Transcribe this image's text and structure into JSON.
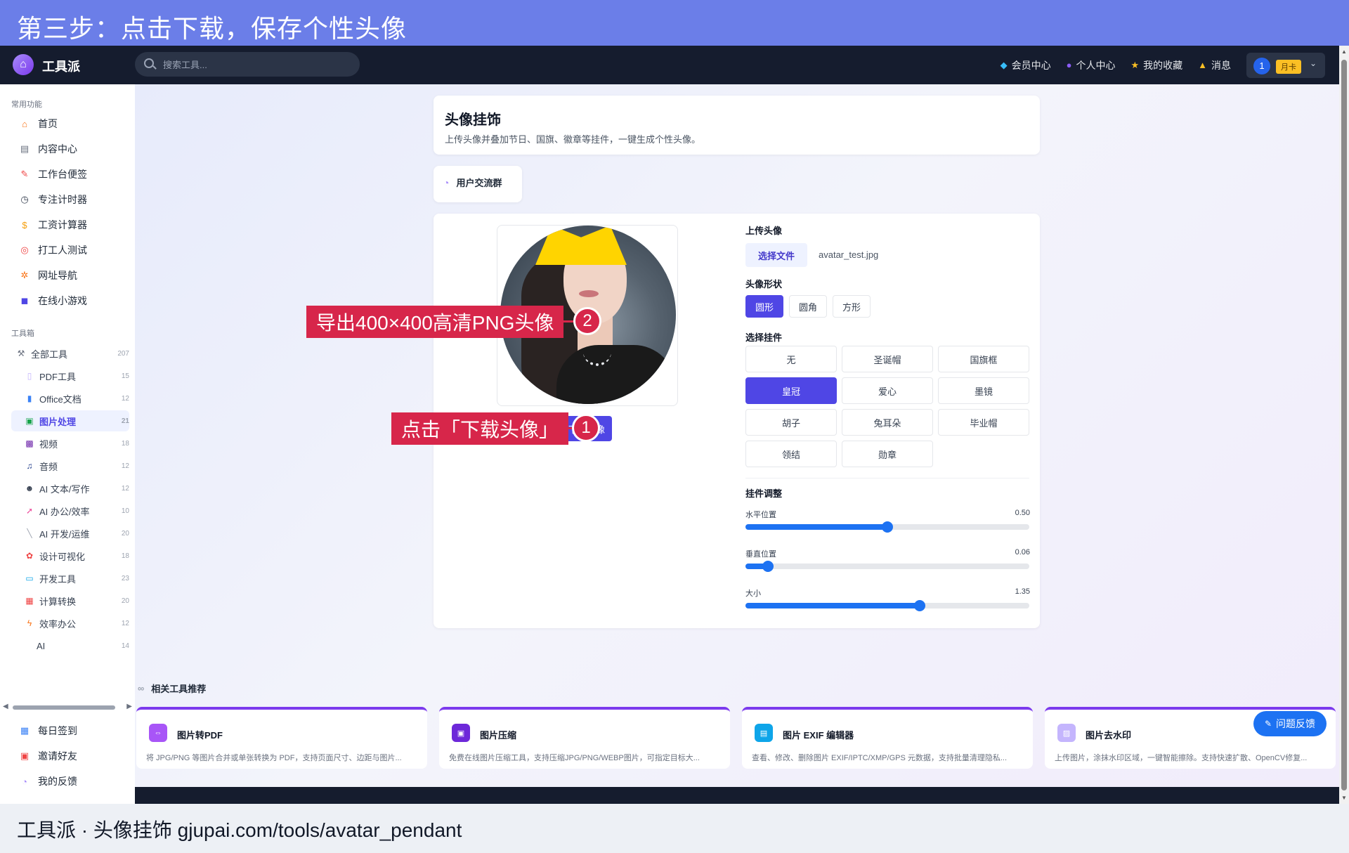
{
  "banner": {
    "title": "第三步：点击下载，保存个性头像"
  },
  "header": {
    "brand": "工具派",
    "search_placeholder": "搜索工具...",
    "nav": [
      {
        "icon": "diamond-icon",
        "label": "会员中心"
      },
      {
        "icon": "user-icon",
        "label": "个人中心"
      },
      {
        "icon": "star-icon",
        "label": "我的收藏"
      },
      {
        "icon": "bell-icon",
        "label": "消息"
      }
    ],
    "user": {
      "avatar_text": "1",
      "plan": "月卡"
    }
  },
  "sidebar": {
    "common_title": "常用功能",
    "common": [
      "首页",
      "内容中心",
      "工作台便签",
      "专注计时器",
      "工资计算器",
      "打工人测试",
      "网址导航",
      "在线小游戏"
    ],
    "toolbox_title": "工具箱",
    "all_tools": {
      "label": "全部工具",
      "count": "207"
    },
    "tools": [
      {
        "label": "PDF工具",
        "count": "15"
      },
      {
        "label": "Office文档",
        "count": "12"
      },
      {
        "label": "图片处理",
        "count": "21",
        "active": true
      },
      {
        "label": "视频",
        "count": "18"
      },
      {
        "label": "音频",
        "count": "12"
      },
      {
        "label": "AI 文本/写作",
        "count": "12"
      },
      {
        "label": "AI 办公/效率",
        "count": "10"
      },
      {
        "label": "AI 开发/运维",
        "count": "20"
      },
      {
        "label": "设计可视化",
        "count": "18"
      },
      {
        "label": "开发工具",
        "count": "23"
      },
      {
        "label": "计算转换",
        "count": "20"
      },
      {
        "label": "效率办公",
        "count": "12"
      },
      {
        "label": "AI",
        "count": "14"
      }
    ],
    "bottom": [
      "每日签到",
      "邀请好友",
      "我的反馈"
    ]
  },
  "page": {
    "title": "头像挂饰",
    "subtitle": "上传头像并叠加节日、国旗、徽章等挂件，一键生成个性头像。",
    "group_button": "用户交流群"
  },
  "editor": {
    "upload_label": "上传头像",
    "choose_file": "选择文件",
    "file_name": "avatar_test.jpg",
    "shape_label": "头像形状",
    "shapes": [
      "圆形",
      "圆角",
      "方形"
    ],
    "shape_selected": "圆形",
    "pendant_label": "选择挂件",
    "pendants": [
      "无",
      "圣诞帽",
      "国旗框",
      "皇冠",
      "爱心",
      "墨镜",
      "胡子",
      "兔耳朵",
      "毕业帽",
      "领结",
      "勋章"
    ],
    "pendant_selected": "皇冠",
    "adjust_label": "挂件调整",
    "sliders": [
      {
        "label": "水平位置",
        "value_text": "0.50",
        "fraction": 0.5
      },
      {
        "label": "垂直位置",
        "value_text": "0.06",
        "fraction": 0.08
      },
      {
        "label": "大小",
        "value_text": "1.35",
        "fraction": 0.613
      }
    ],
    "download_button": "下载头像"
  },
  "related": {
    "title": "相关工具推荐",
    "cards": [
      {
        "title": "图片转PDF",
        "desc": "将 JPG/PNG 等图片合并或单张转换为 PDF，支持页面尺寸、边距与图片...",
        "icon": "pdf-icon",
        "color": "#a855f7"
      },
      {
        "title": "图片压缩",
        "desc": "免费在线图片压缩工具，支持压缩JPG/PNG/WEBP图片，可指定目标大...",
        "icon": "compress-icon",
        "color": "#6d28d9"
      },
      {
        "title": "图片 EXIF 编辑器",
        "desc": "查看、修改、删除图片 EXIF/IPTC/XMP/GPS 元数据，支持批量清理隐私...",
        "icon": "image-icon",
        "color": "#0ea5e9"
      },
      {
        "title": "图片去水印",
        "desc": "上传图片，涂抹水印区域，一键智能擦除。支持快速扩散、OpenCV修复...",
        "icon": "watermark-icon",
        "color": "#c4b5fd"
      }
    ]
  },
  "feedback_button": "问题反馈",
  "annotations": [
    {
      "num": "2",
      "text": "导出400×400高清PNG头像"
    },
    {
      "num": "1",
      "text": "点击「下载头像」"
    }
  ],
  "bottom_caption": "工具派 · 头像挂饰 gjupai.com/tools/avatar_pendant",
  "colors": {
    "accent": "#4f46e5",
    "slider": "#1d72f2",
    "annotation": "#d7264a",
    "banner": "#6b7ee8"
  }
}
